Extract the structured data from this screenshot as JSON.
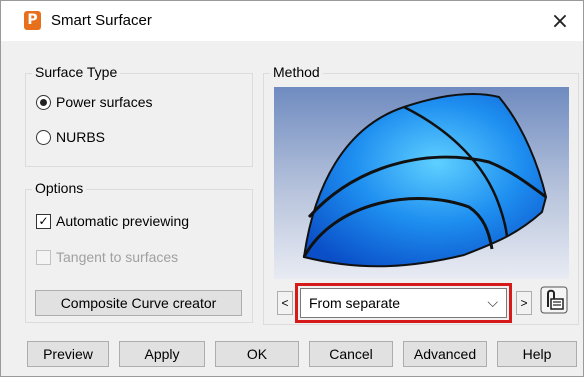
{
  "window": {
    "title": "Smart Surfacer",
    "app_icon_letter": "P",
    "close_glyph": "×"
  },
  "surface_type": {
    "label": "Surface Type",
    "options": [
      {
        "label": "Power surfaces",
        "selected": true
      },
      {
        "label": "NURBS",
        "selected": false
      }
    ]
  },
  "options": {
    "label": "Options",
    "automatic_previewing": {
      "label": "Automatic previewing",
      "checked": true,
      "check_glyph": "✓"
    },
    "tangent_to_surfaces": {
      "label": "Tangent to surfaces",
      "checked": false,
      "enabled": false
    },
    "composite_button": "Composite Curve creator"
  },
  "method": {
    "label": "Method",
    "selected": "From separate",
    "prev_glyph": "<",
    "next_glyph": ">",
    "dropdown_glyph": "⌵",
    "side_icon": "curve-settings-icon"
  },
  "buttons": {
    "preview": "Preview",
    "apply": "Apply",
    "ok": "OK",
    "cancel": "Cancel",
    "advanced": "Advanced",
    "help": "Help"
  }
}
